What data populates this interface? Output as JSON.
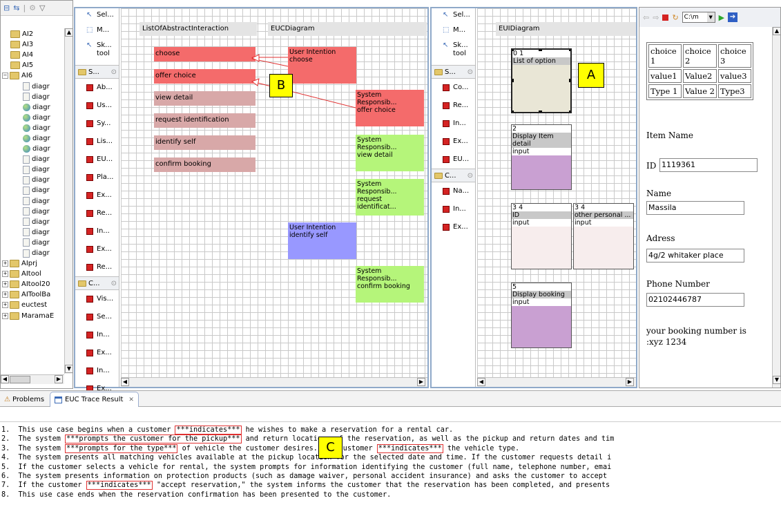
{
  "tree": {
    "items": [
      {
        "type": "folder",
        "label": "AI2",
        "indent": 1
      },
      {
        "type": "folder",
        "label": "AI3",
        "indent": 1
      },
      {
        "type": "folder",
        "label": "AI4",
        "indent": 1
      },
      {
        "type": "folder",
        "label": "AI5",
        "indent": 1
      },
      {
        "type": "folder-open",
        "label": "AI6",
        "indent": 0
      },
      {
        "type": "file",
        "label": "diagr",
        "indent": 2
      },
      {
        "type": "file",
        "label": "diagr",
        "indent": 2
      },
      {
        "type": "globe",
        "label": "diagr",
        "indent": 2
      },
      {
        "type": "globe",
        "label": "diagr",
        "indent": 2
      },
      {
        "type": "globe",
        "label": "diagr",
        "indent": 2
      },
      {
        "type": "globe",
        "label": "diagr",
        "indent": 2
      },
      {
        "type": "globe",
        "label": "diagr",
        "indent": 2
      },
      {
        "type": "file",
        "label": "diagr",
        "indent": 2
      },
      {
        "type": "file",
        "label": "diagr",
        "indent": 2
      },
      {
        "type": "file",
        "label": "diagr",
        "indent": 2
      },
      {
        "type": "file",
        "label": "diagr",
        "indent": 2
      },
      {
        "type": "file",
        "label": "diagr",
        "indent": 2
      },
      {
        "type": "file",
        "label": "diagr",
        "indent": 2
      },
      {
        "type": "file",
        "label": "diagr",
        "indent": 2
      },
      {
        "type": "file",
        "label": "diagr",
        "indent": 2
      },
      {
        "type": "file",
        "label": "diagr",
        "indent": 2
      },
      {
        "type": "file",
        "label": "diagr",
        "indent": 2
      },
      {
        "type": "folder",
        "label": "AIprj",
        "indent": 0
      },
      {
        "type": "folder",
        "label": "AItool",
        "indent": 0
      },
      {
        "type": "folder",
        "label": "AItool20",
        "indent": 0
      },
      {
        "type": "folder",
        "label": "AIToolBa",
        "indent": 0
      },
      {
        "type": "folder",
        "label": "euctest",
        "indent": 0
      },
      {
        "type": "folder",
        "label": "MaramaE",
        "indent": 0
      }
    ]
  },
  "palette1": {
    "tools": [
      "Sel...",
      "M...",
      "Sk...\ntool"
    ],
    "drawer1": "S...",
    "drawer1_items": [
      "Ab...",
      "Us...",
      "Sy...",
      "Lis...",
      "EU...",
      "Pla...",
      "Ex...",
      "Re...",
      "In...",
      "Ex...",
      "Re..."
    ],
    "drawer2": "C...",
    "drawer2_items": [
      "Vis...",
      "Se...",
      "In...",
      "Ex...",
      "In...",
      "Ex..."
    ]
  },
  "euc_canvas": {
    "header_left": "ListOfAbstractInteraction",
    "header_right": "EUCDiagram",
    "abstract_items": [
      {
        "label": "choose",
        "color": "#f46b6b"
      },
      {
        "label": "offer choice",
        "color": "#f46b6b"
      },
      {
        "label": "view detail",
        "color": "#d8a8a8"
      },
      {
        "label": "request identification",
        "color": "#d8a8a8"
      },
      {
        "label": "identify self",
        "color": "#d8a8a8"
      },
      {
        "label": "confirm booking",
        "color": "#d8a8a8"
      }
    ],
    "nodes": [
      {
        "text": "User Intention\nchoose",
        "color": "#f46b6b"
      },
      {
        "text": "System Responsib...\noffer choice",
        "color": "#f46b6b"
      },
      {
        "text": "System Responsib...\nview detail",
        "color": "#b5f57a"
      },
      {
        "text": "System Responsib...\nrequest identificat...",
        "color": "#b5f57a"
      },
      {
        "text": "User Intention\nidentify self",
        "color": "#9898ff"
      },
      {
        "text": "System Responsib...\nconfirm booking",
        "color": "#b5f57a"
      }
    ],
    "callout": "B"
  },
  "palette2": {
    "tools": [
      "Sel...",
      "M...",
      "Sk...\ntool"
    ],
    "drawer1": "S...",
    "drawer1_items": [
      "Co...",
      "Re...",
      "In...",
      "Ex...",
      "EU..."
    ],
    "drawer2": "C...",
    "drawer2_items": [
      "Na...",
      "In...",
      "Ex..."
    ]
  },
  "eui_canvas": {
    "header": "EUIDiagram",
    "boxes": [
      {
        "num": "0 1",
        "title": "List of option",
        "sub": "",
        "color": "#e9e6d6"
      },
      {
        "num": "2",
        "title": "Display Item detail",
        "sub": "input",
        "color": "#c9a0d2"
      },
      {
        "num": "3 4",
        "title": "ID",
        "sub": "input",
        "color": "#f7eded"
      },
      {
        "num": "3 4",
        "title": "other personal ...",
        "sub": "input",
        "color": "#f7eded"
      },
      {
        "num": "5",
        "title": "Display booking",
        "sub": "input",
        "color": "#c9a0d2"
      }
    ],
    "callout": "A"
  },
  "browser": {
    "address": "C:\\m",
    "table": [
      [
        "choice\n1",
        "choice\n2",
        "choice\n3"
      ],
      [
        "value1",
        "Value2",
        "value3"
      ],
      [
        "Type 1",
        "Value 2",
        "Type3"
      ]
    ],
    "item_name": "Item Name",
    "id_label": "ID",
    "id_value": "1119361",
    "name_label": "Name",
    "name_value": "Massila",
    "adress_label": "Adress",
    "adress_value": "4g/2 whitaker place",
    "phone_label": "Phone Number",
    "phone_value": "02102446787",
    "booking_text": "your booking number is :xyz 1234"
  },
  "bottom_tabs": {
    "problems": "Problems",
    "trace": "EUC Trace Result",
    "close": "✕"
  },
  "trace": {
    "callout": "C",
    "lines": [
      [
        "1.  This use case begins when a customer ",
        {
          "m": "***indicates***"
        },
        " he wishes to make a reservation for a rental car."
      ],
      [
        "2.  The system ",
        {
          "m": "***prompts the customer for the pickup***"
        },
        " and return locations of the reservation, as well as the pickup and return dates and tim"
      ],
      [
        "3.  The system ",
        {
          "m": "***prompts for the type***"
        },
        " of vehicle the customer desires. The customer ",
        {
          "m": "***indicates***"
        },
        " the vehicle type."
      ],
      [
        "4.  The system presents all matching vehicles available at the pickup location for the selected date and time. If the customer requests detail i"
      ],
      [
        "5.  If the customer selects a vehicle for rental, the system prompts for information identifying the customer (full name, telephone number, emai"
      ],
      [
        "6.  The system presents information on protection products (such as damage waiver, personal accident insurance) and asks the customer to accept"
      ],
      [
        "7.  If the customer ",
        {
          "m": "***indicates***"
        },
        " \"accept reservation,\" the system informs the customer that the reservation has been completed, and presents"
      ],
      [
        "8.  This use case ends when the reservation confirmation has been presented to the customer."
      ]
    ]
  }
}
